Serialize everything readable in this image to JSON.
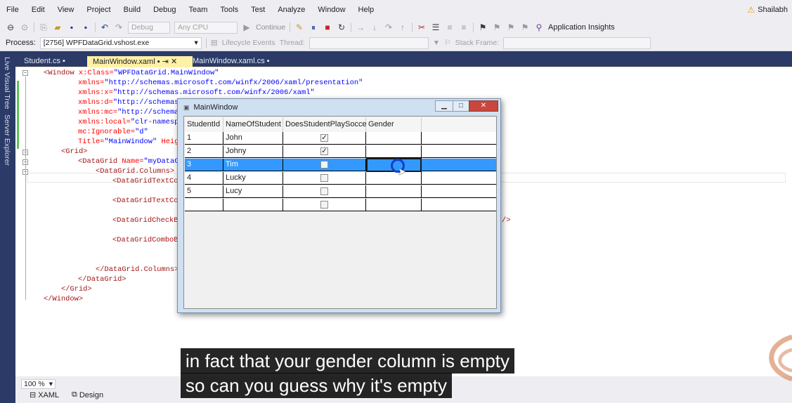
{
  "menu": {
    "items": [
      "File",
      "Edit",
      "View",
      "Project",
      "Build",
      "Debug",
      "Team",
      "Tools",
      "Test",
      "Analyze",
      "Window",
      "Help"
    ],
    "user": "Shailabh"
  },
  "toolbar": {
    "config_combo": "Debug",
    "platform_combo": "Any CPU",
    "continue_label": "Continue",
    "insights_label": "Application Insights"
  },
  "procbar": {
    "process_label": "Process:",
    "process_value": "[2756] WPFDataGrid.vshost.exe",
    "lifecycle_label": "Lifecycle Events",
    "thread_label": "Thread:",
    "stackframe_label": "Stack Frame:"
  },
  "left_strip": {
    "live_visual_tree": "Live Visual Tree",
    "server_explorer": "Server Explorer"
  },
  "tabs": [
    {
      "label": "Student.cs"
    },
    {
      "label": "MainWindow.xaml"
    },
    {
      "label": "MainWindow.xaml.cs"
    }
  ],
  "code": {
    "l1_tag": "<Window",
    "l1_attr": " x:Class=",
    "l1_val": "\"WPFDataGrid.MainWindow\"",
    "l2_attr": "xmlns=",
    "l2_val": "\"http://schemas.microsoft.com/winfx/2006/xaml/presentation\"",
    "l3_attr": "xmlns:x=",
    "l3_val": "\"http://schemas.microsoft.com/winfx/2006/xaml\"",
    "l4_attr": "xmlns:d=",
    "l4_val": "\"http://schemas",
    "l5_attr": "xmlns:mc=",
    "l5_val": "\"http://schema",
    "l6_attr": "xmlns:local=",
    "l6_val": "\"clr-namesp",
    "l7_attr": "mc:Ignorable=",
    "l7_val": "\"d\"",
    "l8_attr": "Title=",
    "l8_val": "\"MainWindow\"",
    "l8_tail": " Heig",
    "l9": "<Grid>",
    "l10_tag": "<DataGrid",
    "l10_attr": " Name=",
    "l10_val": "\"myDataG",
    "l11": "<DataGrid.Columns>",
    "l12": "<DataGridTextCo",
    "l13": "<DataGridTextCo",
    "l14": "<DataGridCheckB",
    "l14_tail": "/>",
    "l15": "<DataGridComboB",
    "l16": "</DataGrid.Columns>",
    "l17": "</DataGrid>",
    "l18": "</Grid>",
    "l19": "</Window>"
  },
  "wpf_window": {
    "title": "MainWindow",
    "columns": [
      "StudentId",
      "NameOfStudent",
      "DoesStudentPlaySoccer",
      "Gender"
    ],
    "rows": [
      {
        "id": "1",
        "name": "John",
        "soccer": true,
        "gender": ""
      },
      {
        "id": "2",
        "name": "Johny",
        "soccer": true,
        "gender": ""
      },
      {
        "id": "3",
        "name": "Tim",
        "soccer": false,
        "gender": ""
      },
      {
        "id": "4",
        "name": "Lucky",
        "soccer": false,
        "gender": ""
      },
      {
        "id": "5",
        "name": "Lucy",
        "soccer": false,
        "gender": ""
      },
      {
        "id": "",
        "name": "",
        "soccer": false,
        "gender": ""
      }
    ]
  },
  "bottom": {
    "zoom": "100 %",
    "xaml_tab": "XAML",
    "design_tab": "Design"
  },
  "captions": {
    "line1": "in fact that your gender column is empty",
    "line2": "so can you guess why it's empty"
  },
  "colors": {
    "accent_tab": "#fff1a6",
    "selection": "#3399ff",
    "ide_frame": "#2b3a67"
  }
}
